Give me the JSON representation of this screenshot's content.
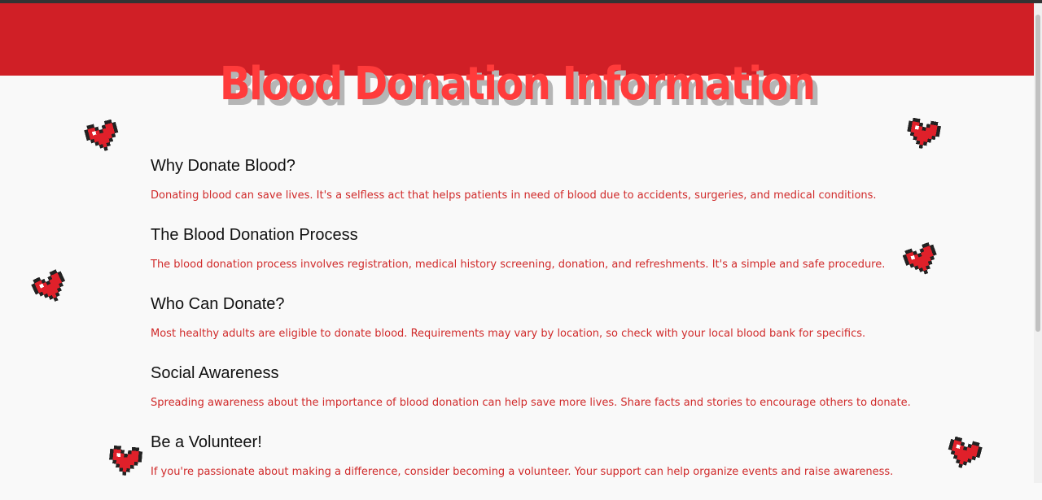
{
  "page": {
    "title": "Blood Donation Information"
  },
  "colors": {
    "header_band": "#d01f26",
    "title": "#ff3b3b",
    "title_shadow": "#b5b5b5",
    "section_text": "#d02a2a",
    "heading_text": "#111111"
  },
  "sections": [
    {
      "heading": "Why Donate Blood?",
      "text": "Donating blood can save lives. It's a selfless act that helps patients in need of blood due to accidents, surgeries, and medical conditions."
    },
    {
      "heading": "The Blood Donation Process",
      "text": "The blood donation process involves registration, medical history screening, donation, and refreshments. It's a simple and safe procedure."
    },
    {
      "heading": "Who Can Donate?",
      "text": "Most healthy adults are eligible to donate blood. Requirements may vary by location, so check with your local blood bank for specifics."
    },
    {
      "heading": "Social Awareness",
      "text": "Spreading awareness about the importance of blood donation can help save more lives. Share facts and stories to encourage others to donate."
    },
    {
      "heading": "Be a Volunteer!",
      "text": "If you're passionate about making a difference, consider becoming a volunteer. Your support can help organize events and raise awareness."
    }
  ],
  "decorations": {
    "hearts": [
      "pixel-heart-icon",
      "pixel-heart-icon",
      "pixel-heart-icon",
      "pixel-heart-icon",
      "pixel-heart-icon",
      "pixel-heart-icon"
    ]
  }
}
